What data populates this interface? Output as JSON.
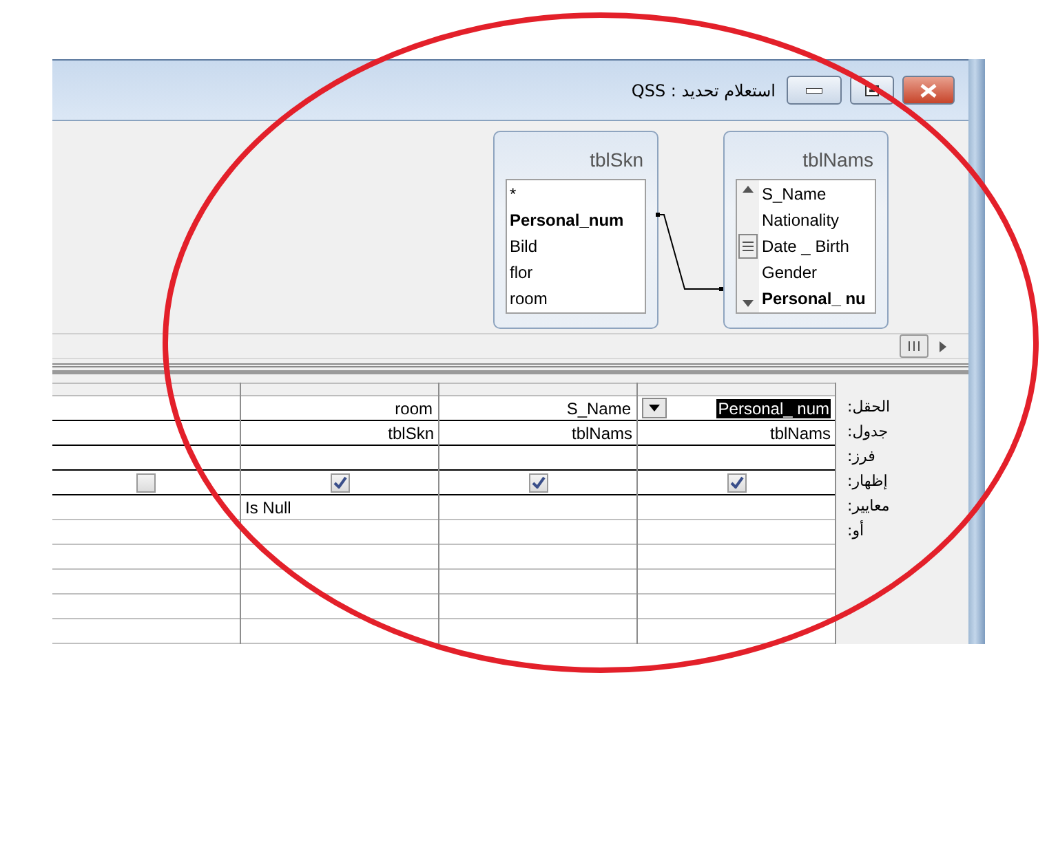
{
  "window": {
    "title": "استعلام تحديد : QSS"
  },
  "tables": [
    {
      "name": "tblSkn",
      "scrollbar": false,
      "fields": [
        {
          "name": "*",
          "key": false
        },
        {
          "name": "Personal_num",
          "key": true
        },
        {
          "name": "Bild",
          "key": false
        },
        {
          "name": "flor",
          "key": false
        },
        {
          "name": "room",
          "key": false
        }
      ]
    },
    {
      "name": "tblNams",
      "scrollbar": true,
      "fields": [
        {
          "name": "S_Name",
          "key": false
        },
        {
          "name": "Nationality",
          "key": false
        },
        {
          "name": "Date _ Birth",
          "key": false
        },
        {
          "name": "Gender",
          "key": false
        },
        {
          "name": "Personal_ nu",
          "key": true
        }
      ]
    }
  ],
  "columns": [
    {
      "show": false,
      "selected": false
    },
    {
      "field": "room",
      "table": "tblSkn",
      "show": true,
      "selected": false,
      "criteria": "Is Null"
    },
    {
      "field": "S_Name",
      "table": "tblNams",
      "show": true,
      "selected": false
    },
    {
      "field": "Personal_ num",
      "table": "tblNams",
      "show": true,
      "selected": true
    }
  ],
  "row_labels": [
    "الحقل:",
    "جدول:",
    "فرز:",
    "إظهار:",
    "معايير:",
    "أو:"
  ]
}
